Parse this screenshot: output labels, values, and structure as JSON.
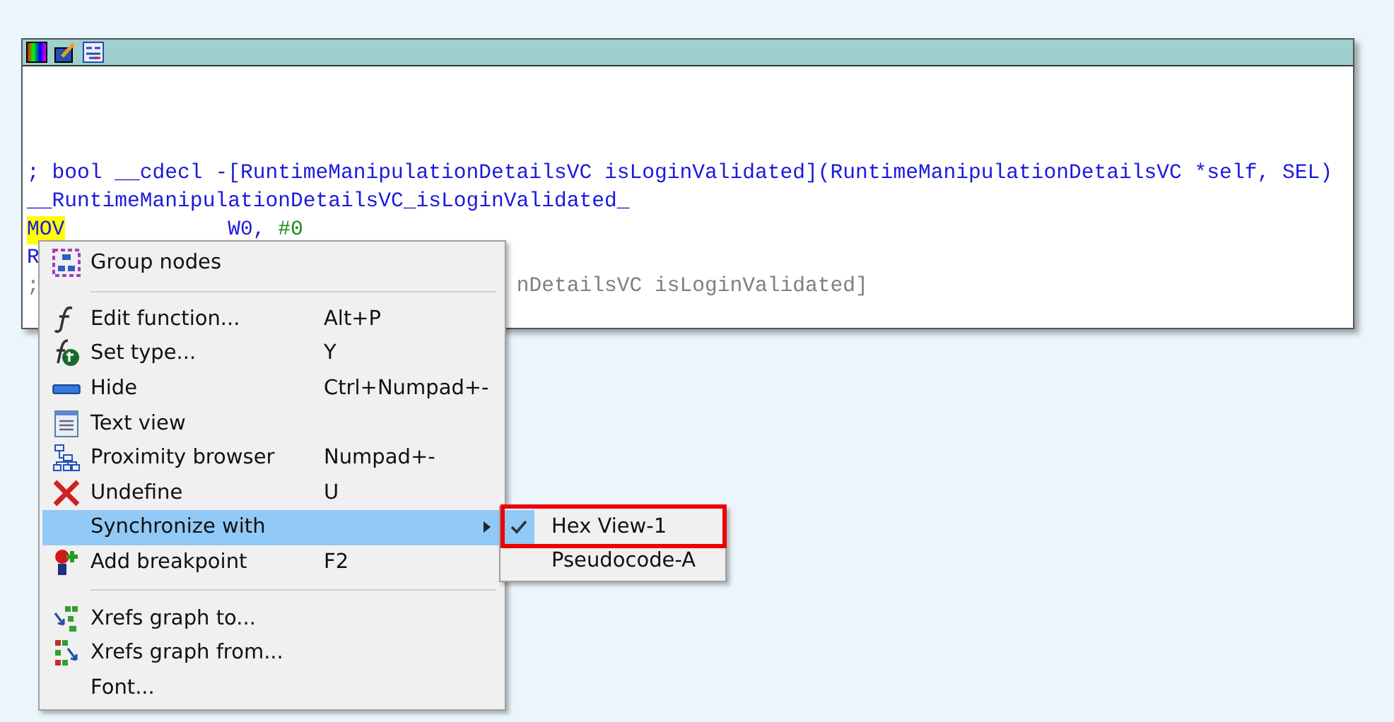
{
  "code_lines": [
    {
      "kind": "comment",
      "text": "; bool __cdecl -[RuntimeManipulationDetailsVC isLoginValidated](RuntimeManipulationDetailsVC *self, SEL)"
    },
    {
      "kind": "label",
      "text": "__RuntimeManipulationDetailsVC_isLoginValidated_"
    },
    {
      "kind": "instruction",
      "mnemonic": "MOV",
      "operand_1": "W0,",
      "operand_2": "#0",
      "selected": true
    },
    {
      "kind": "partial",
      "text": "R"
    },
    {
      "kind": "split_comment",
      "left": ";",
      "right": "nDetailsVC isLoginValidated]"
    }
  ],
  "context_menu": {
    "items": [
      {
        "kind": "item",
        "label": "Group nodes",
        "selected": false
      },
      {
        "kind": "separator"
      },
      {
        "kind": "item",
        "label": "Edit function...",
        "shortcut": "Alt+P",
        "selected": false
      },
      {
        "kind": "item",
        "label": "Set type...",
        "shortcut": "Y",
        "selected": false
      },
      {
        "kind": "item",
        "label": "Hide",
        "shortcut": "Ctrl+Numpad+-",
        "selected": false
      },
      {
        "kind": "item",
        "label": "Text view",
        "selected": false
      },
      {
        "kind": "item",
        "label": "Proximity browser",
        "shortcut": "Numpad+-",
        "selected": false
      },
      {
        "kind": "item",
        "label": "Undefine",
        "shortcut": "U",
        "selected": false
      },
      {
        "kind": "item",
        "label": "Synchronize with",
        "selected": true,
        "submenu": true
      },
      {
        "kind": "item",
        "label": "Add breakpoint",
        "shortcut": "F2",
        "selected": false
      },
      {
        "kind": "separator"
      },
      {
        "kind": "item",
        "label": "Xrefs graph to...",
        "selected": false
      },
      {
        "kind": "item",
        "label": "Xrefs graph from...",
        "selected": false
      },
      {
        "kind": "item",
        "label": "Font...",
        "selected": false
      }
    ]
  },
  "submenu": {
    "items": [
      {
        "label": "Hex View-1",
        "checked": true,
        "annotated": true
      },
      {
        "label": "Pseudocode-A",
        "checked": false,
        "annotated": false
      }
    ]
  }
}
